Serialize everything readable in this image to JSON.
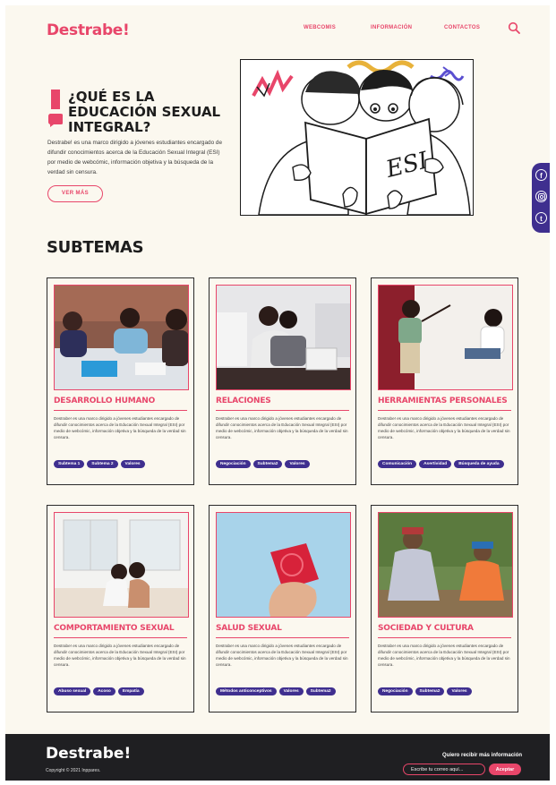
{
  "header": {
    "logo": "Destrabe!",
    "nav": [
      "WEBCOMIS",
      "INFORMACIÓN",
      "CONTACTOS"
    ],
    "search_icon": "search-icon"
  },
  "hero": {
    "title": "¿QUÉ ES LA EDUCACIÓN SEXUAL INTEGRAL?",
    "description": "Destrabe! es una marco dirigido a jóvenes estudiantes encargado de difundir conocimientos acerca de la Educación Sexual Integral (ESI) por medio de webcómic, información objetiva y la búsqueda de la verdad sin censura.",
    "button": "VER MÁS",
    "comic_text": "ESI"
  },
  "social": [
    "facebook-icon",
    "instagram-icon",
    "tumblr-icon"
  ],
  "subtemas_title": "SUBTEMAS",
  "cards": [
    {
      "title": "DESARROLLO HUMANO",
      "description": "Destrabe! es una marco dirigido a jóvenes estudiantes encargado de difundir conocimientos acerca de la Educación Sexual Integral (ESI) por medio de webcómic, información objetiva y la búsqueda de la verdad sin censura.",
      "tags": [
        "Subtema 1",
        "Subtema 2",
        "Valores"
      ]
    },
    {
      "title": "RELACIONES",
      "description": "Destrabe! es una marco dirigido a jóvenes estudiantes encargado de difundir conocimientos acerca de la Educación Sexual Integral (ESI) por medio de webcómic, información objetiva y la búsqueda de la verdad sin censura.",
      "tags": [
        "Negociación",
        "Subtema2",
        "Valores"
      ]
    },
    {
      "title": "HERRAMIENTAS PERSONALES",
      "description": "Destrabe! es una marco dirigido a jóvenes estudiantes encargado de difundir conocimientos acerca de la Educación Sexual Integral (ESI) por medio de webcómic, información objetiva y la búsqueda de la verdad sin censura.",
      "tags": [
        "Comunicación",
        "Asertividad",
        "Búsqueda de ayuda"
      ]
    },
    {
      "title": "COMPORTAMIENTO SEXUAL",
      "description": "Destrabe! es una marco dirigido a jóvenes estudiantes encargado de difundir conocimientos acerca de la Educación Sexual Integral (ESI) por medio de webcómic, información objetiva y la búsqueda de la verdad sin censura.",
      "tags": [
        "Abuso sexual",
        "Acoso",
        "Empatía"
      ]
    },
    {
      "title": "SALUD SEXUAL",
      "description": "Destrabe! es una marco dirigido a jóvenes estudiantes encargado de difundir conocimientos acerca de la Educación Sexual Integral (ESI) por medio de webcómic, información objetiva y la búsqueda de la verdad sin censura.",
      "tags": [
        "Métodos anticonceptivos",
        "Valores",
        "Subtema2"
      ]
    },
    {
      "title": "SOCIEDAD Y CULTURA",
      "description": "Destrabe! es una marco dirigido a jóvenes estudiantes encargado de difundir conocimientos acerca de la Educación Sexual Integral (ESI) por medio de webcómic, información objetiva y la búsqueda de la verdad sin censura.",
      "tags": [
        "Negociación",
        "Subtema2",
        "Valores"
      ]
    }
  ],
  "footer": {
    "logo": "Destrabe!",
    "copyright": "Copyright © 2021 Inppares.",
    "cta": "Quiero recibir más información",
    "email_placeholder": "Escribe tu correo aquí...",
    "accept": "Aceptar"
  },
  "colors": {
    "accent": "#e8466a",
    "purple": "#3f2f8f",
    "background": "#fbf8ef",
    "footer": "#1f1f22"
  }
}
